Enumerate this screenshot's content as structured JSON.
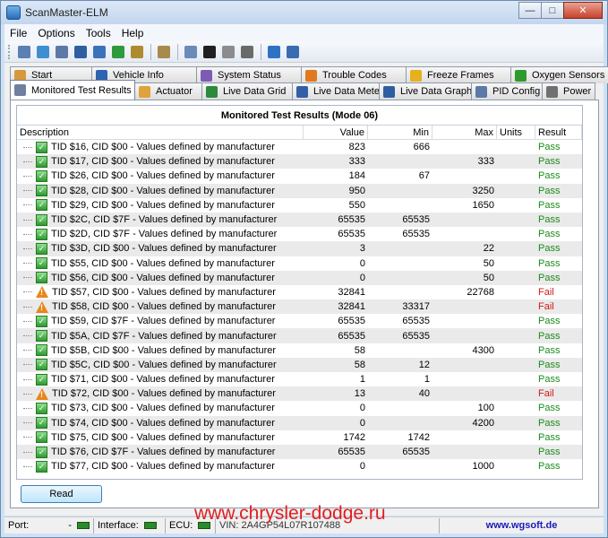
{
  "window": {
    "title": "ScanMaster-ELM",
    "buttons": {
      "minimize": "—",
      "maximize": "□",
      "close": "✕"
    }
  },
  "menu": [
    "File",
    "Options",
    "Tools",
    "Help"
  ],
  "toolbar": {
    "icons": [
      {
        "name": "connect-icon",
        "color": "#5a7fb3"
      },
      {
        "name": "globe-icon",
        "color": "#3f8fd0"
      },
      {
        "name": "document-icon",
        "color": "#5c79a8"
      },
      {
        "name": "grid-icon",
        "color": "#2f5fa0"
      },
      {
        "name": "chart-icon",
        "color": "#3b73b8"
      },
      {
        "name": "report-icon",
        "color": "#2d9a3b"
      },
      {
        "name": "dollar-icon",
        "color": "#b08a2e"
      },
      {
        "name": "clipboard-icon",
        "color": "#a88a4d"
      },
      {
        "name": "comment-icon",
        "color": "#6a8ab8"
      },
      {
        "name": "terminal-icon",
        "color": "#202020"
      },
      {
        "name": "battery-icon",
        "color": "#8c8c8c"
      },
      {
        "name": "power-icon",
        "color": "#6a6a6a"
      },
      {
        "name": "info-icon",
        "color": "#2f72c4"
      },
      {
        "name": "exit-icon",
        "color": "#3a6db0"
      }
    ]
  },
  "tabs": {
    "row1": [
      {
        "label": "Start",
        "icon": "start-icon",
        "color": "#d49a3c"
      },
      {
        "label": "Vehicle Info",
        "icon": "info-icon",
        "color": "#2f62b0"
      },
      {
        "label": "System Status",
        "icon": "status-icon",
        "color": "#7d5bb5"
      },
      {
        "label": "Trouble Codes",
        "icon": "warning-icon",
        "color": "#e07a1c"
      },
      {
        "label": "Freeze Frames",
        "icon": "freeze-icon",
        "color": "#e8b020"
      },
      {
        "label": "Oxygen Sensors",
        "icon": "oxygen-icon",
        "color": "#2e9a2e"
      }
    ],
    "row2": [
      {
        "label": "Monitored Test Results",
        "icon": "gear-icon",
        "color": "#6f7fa0",
        "active": true
      },
      {
        "label": "Actuator",
        "icon": "actuator-icon",
        "color": "#e0a23a"
      },
      {
        "label": "Live Data Grid",
        "icon": "grid-icon",
        "color": "#2c8a3c"
      },
      {
        "label": "Live Data Meter",
        "icon": "meter-icon",
        "color": "#3260a8"
      },
      {
        "label": "Live Data Graph",
        "icon": "graph-icon",
        "color": "#2c5fa0"
      },
      {
        "label": "PID Config",
        "icon": "config-icon",
        "color": "#5c79a8"
      },
      {
        "label": "Power",
        "icon": "power-icon",
        "color": "#707070"
      }
    ]
  },
  "results": {
    "title": "Monitored Test Results (Mode 06)",
    "columns": [
      "Description",
      "Value",
      "Min",
      "Max",
      "Units",
      "Result"
    ],
    "rows": [
      {
        "desc": "TID $16, CID $00 - Values defined by manufacturer",
        "value": "823",
        "min": "666",
        "max": "",
        "units": "",
        "result": "Pass"
      },
      {
        "desc": "TID $17, CID $00 - Values defined by manufacturer",
        "value": "333",
        "min": "",
        "max": "333",
        "units": "",
        "result": "Pass"
      },
      {
        "desc": "TID $26, CID $00 - Values defined by manufacturer",
        "value": "184",
        "min": "67",
        "max": "",
        "units": "",
        "result": "Pass"
      },
      {
        "desc": "TID $28, CID $00 - Values defined by manufacturer",
        "value": "950",
        "min": "",
        "max": "3250",
        "units": "",
        "result": "Pass"
      },
      {
        "desc": "TID $29, CID $00 - Values defined by manufacturer",
        "value": "550",
        "min": "",
        "max": "1650",
        "units": "",
        "result": "Pass"
      },
      {
        "desc": "TID $2C, CID $7F - Values defined by manufacturer",
        "value": "65535",
        "min": "65535",
        "max": "",
        "units": "",
        "result": "Pass"
      },
      {
        "desc": "TID $2D, CID $7F - Values defined by manufacturer",
        "value": "65535",
        "min": "65535",
        "max": "",
        "units": "",
        "result": "Pass"
      },
      {
        "desc": "TID $3D, CID $00 - Values defined by manufacturer",
        "value": "3",
        "min": "",
        "max": "22",
        "units": "",
        "result": "Pass"
      },
      {
        "desc": "TID $55, CID $00 - Values defined by manufacturer",
        "value": "0",
        "min": "",
        "max": "50",
        "units": "",
        "result": "Pass"
      },
      {
        "desc": "TID $56, CID $00 - Values defined by manufacturer",
        "value": "0",
        "min": "",
        "max": "50",
        "units": "",
        "result": "Pass"
      },
      {
        "desc": "TID $57, CID $00 - Values defined by manufacturer",
        "value": "32841",
        "min": "",
        "max": "22768",
        "units": "",
        "result": "Fail"
      },
      {
        "desc": "TID $58, CID $00 - Values defined by manufacturer",
        "value": "32841",
        "min": "33317",
        "max": "",
        "units": "",
        "result": "Fail"
      },
      {
        "desc": "TID $59, CID $7F - Values defined by manufacturer",
        "value": "65535",
        "min": "65535",
        "max": "",
        "units": "",
        "result": "Pass"
      },
      {
        "desc": "TID $5A, CID $7F - Values defined by manufacturer",
        "value": "65535",
        "min": "65535",
        "max": "",
        "units": "",
        "result": "Pass"
      },
      {
        "desc": "TID $5B, CID $00 - Values defined by manufacturer",
        "value": "58",
        "min": "",
        "max": "4300",
        "units": "",
        "result": "Pass"
      },
      {
        "desc": "TID $5C, CID $00 - Values defined by manufacturer",
        "value": "58",
        "min": "12",
        "max": "",
        "units": "",
        "result": "Pass"
      },
      {
        "desc": "TID $71, CID $00 - Values defined by manufacturer",
        "value": "1",
        "min": "1",
        "max": "",
        "units": "",
        "result": "Pass"
      },
      {
        "desc": "TID $72, CID $00 - Values defined by manufacturer",
        "value": "13",
        "min": "40",
        "max": "",
        "units": "",
        "result": "Fail"
      },
      {
        "desc": "TID $73, CID $00 - Values defined by manufacturer",
        "value": "0",
        "min": "",
        "max": "100",
        "units": "",
        "result": "Pass"
      },
      {
        "desc": "TID $74, CID $00 - Values defined by manufacturer",
        "value": "0",
        "min": "",
        "max": "4200",
        "units": "",
        "result": "Pass"
      },
      {
        "desc": "TID $75, CID $00 - Values defined by manufacturer",
        "value": "1742",
        "min": "1742",
        "max": "",
        "units": "",
        "result": "Pass"
      },
      {
        "desc": "TID $76, CID $7F - Values defined by manufacturer",
        "value": "65535",
        "min": "65535",
        "max": "",
        "units": "",
        "result": "Pass"
      },
      {
        "desc": "TID $77, CID $00 - Values defined by manufacturer",
        "value": "0",
        "min": "",
        "max": "1000",
        "units": "",
        "result": "Pass"
      }
    ]
  },
  "read_button": "Read",
  "watermark": "www.chrysler-dodge.ru",
  "status": {
    "port_label": "Port:",
    "port_value": "-",
    "interface_label": "Interface:",
    "ecu_label": "ECU:",
    "vin": "VIN: 2A4GP54L07R107488",
    "link": "www.wgsoft.de"
  },
  "colors": {
    "pass": "#1b8c1b",
    "fail": "#d21b1b",
    "led": "#2c8a2c"
  }
}
